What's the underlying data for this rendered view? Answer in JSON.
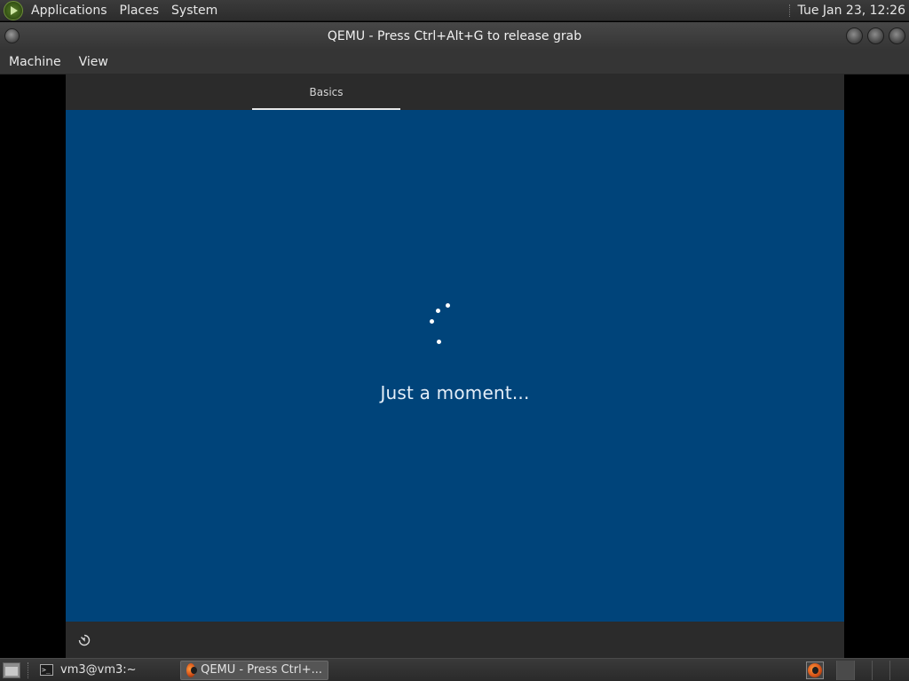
{
  "top_panel": {
    "menus": [
      "Applications",
      "Places",
      "System"
    ],
    "clock": "Tue Jan 23, 12:26"
  },
  "window": {
    "title": "QEMU - Press Ctrl+Alt+G to release grab",
    "menubar": [
      "Machine",
      "View"
    ]
  },
  "guest": {
    "tab_label": "Basics",
    "status_text": "Just a moment...",
    "background_color": "#00447a",
    "accessibility_icon": "ease-of-access-icon"
  },
  "taskbar": {
    "tasks": [
      {
        "label": "vm3@vm3:~",
        "icon": "terminal-icon",
        "active": false
      },
      {
        "label": "QEMU - Press Ctrl+...",
        "icon": "qemu-icon",
        "active": true
      }
    ],
    "tray_icon": "qemu-icon",
    "workspaces": 4
  }
}
